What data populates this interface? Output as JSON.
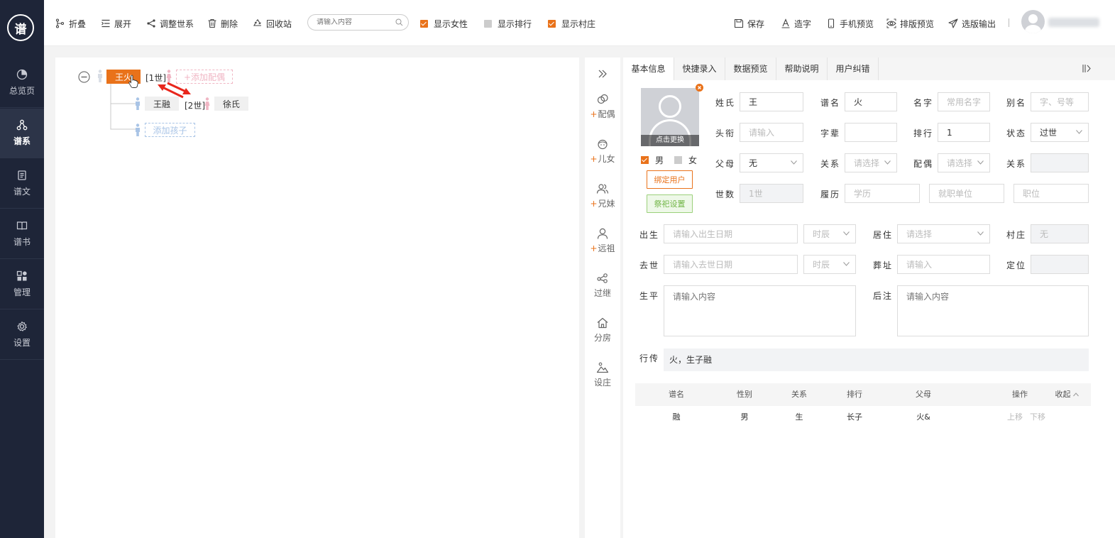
{
  "colors": {
    "accent": "#e9721a",
    "sidebar": "#1e2538",
    "male": "#a9c4e6",
    "female": "#f0b6c4",
    "green": "#6fb443",
    "arrow": "#e8261c"
  },
  "sidebar": {
    "logo": "谱",
    "items": [
      {
        "label": "总览页",
        "icon": "pie-chart-icon"
      },
      {
        "label": "谱系",
        "icon": "tree-icon"
      },
      {
        "label": "谱文",
        "icon": "document-icon"
      },
      {
        "label": "谱书",
        "icon": "book-icon"
      },
      {
        "label": "管理",
        "icon": "grid-icon"
      },
      {
        "label": "设置",
        "icon": "gear-icon"
      }
    ]
  },
  "toolbar": {
    "fold": "折叠",
    "expand": "展开",
    "adjust": "调整世系",
    "delete": "删除",
    "recycle": "回收站",
    "search_placeholder": "请输入内容",
    "show_female": "显示女性",
    "show_rank": "显示排行",
    "show_village": "显示村庄",
    "save": "保存",
    "make_char": "造字",
    "mobile_preview": "手机预览",
    "layout_preview": "排版预览",
    "export": "选版输出"
  },
  "tree": {
    "root_name": "王火",
    "root_gen": "[1世]",
    "add_spouse": "+添加配偶",
    "child_name": "王融",
    "child_gen": "[2世]",
    "child_spouse": "徐氏",
    "add_child": "添加孩子"
  },
  "actions": {
    "plus": "+",
    "spouse": "配偶",
    "children": "儿女",
    "siblings": "兄妹",
    "ancestor": "远祖",
    "adopt": "过继",
    "branch": "分房",
    "village": "设庄"
  },
  "tabs": [
    "基本信息",
    "快捷录入",
    "数据预览",
    "帮助说明",
    "用户纠错"
  ],
  "form": {
    "photo_change": "点击更换",
    "male": "男",
    "female": "女",
    "bind_user": "绑定用户",
    "worship": "祭祀设置",
    "surname_label": "姓氏",
    "surname": "王",
    "pu_name_label": "谱名",
    "pu_name": "火",
    "given_label": "名字",
    "given_ph": "常用名字",
    "alias_label": "别名",
    "alias_ph": "字、号等",
    "title_label": "头衔",
    "title_ph": "请输入",
    "zibei_label": "字辈",
    "zibei": "",
    "rank_label": "排行",
    "rank": "1",
    "status_label": "状态",
    "status": "过世",
    "parent_label": "父母",
    "parent": "无",
    "rel_label": "关系",
    "select_ph": "请选择",
    "spouse_label": "配偶",
    "rel2_label": "关系",
    "gen_label": "世数",
    "gen": "1世",
    "resume_label": "履历",
    "edu_ph": "学历",
    "employer_ph": "就职单位",
    "position_ph": "职位",
    "birth_label": "出生",
    "birth_ph": "请输入出生日期",
    "hour_ph": "时辰",
    "live_label": "居住",
    "village_label": "村庄",
    "village": "无",
    "death_label": "去世",
    "death_ph": "请输入去世日期",
    "burial_label": "葬址",
    "burial_ph": "请输入",
    "locate_label": "定位",
    "life_label": "生平",
    "content_ph": "请输入内容",
    "note_label": "后注",
    "bio_label": "行传",
    "bio": "火，生子融"
  },
  "children_table": {
    "headers": [
      "谱名",
      "性别",
      "关系",
      "排行",
      "父母",
      "操作"
    ],
    "collapse": "收起",
    "rows": [
      {
        "name": "融",
        "gender": "男",
        "relation": "生",
        "rank": "长子",
        "parents": "火&",
        "up": "上移",
        "down": "下移"
      }
    ]
  }
}
